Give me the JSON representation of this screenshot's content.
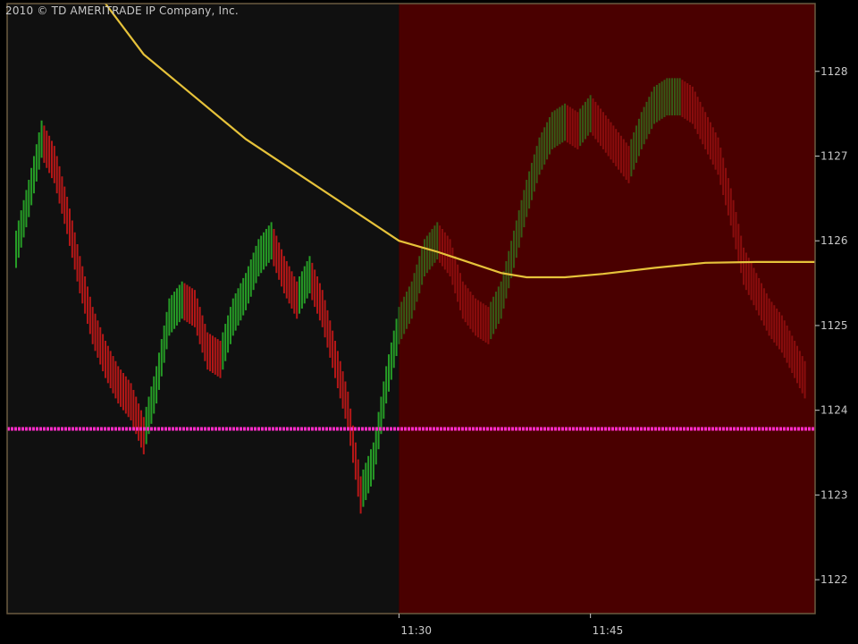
{
  "window": {
    "copyright": "2010 © TD AMERITRADE IP Company, Inc."
  },
  "colors": {
    "background": "#000000",
    "pre_session_bg": "#101010",
    "session_bg": "#4a0000",
    "up_bar": "#28a428",
    "down_bar": "#c01818",
    "moving_average": "#e6c23a",
    "support_line": "#ff2cc8",
    "axis_text": "#c8c8c8",
    "frame": "#6a5a40"
  },
  "chart_data": {
    "type": "line",
    "y_axis_ticks": [
      1128,
      1127,
      1126,
      1125,
      1124,
      1123,
      1122
    ],
    "ylim": [
      1121.6,
      1128.8
    ],
    "x_ticks": [
      {
        "label": "11:30",
        "minute": 30
      },
      {
        "label": "11:45",
        "minute": 45
      }
    ],
    "xlim_minutes": [
      -0.7,
      62.6
    ],
    "session_start_minute": 30,
    "horizontal_line": {
      "name": "",
      "value": 1123.78
    },
    "series": [
      {
        "series_type": "price_bars",
        "points": [
          [
            0,
            1125.9
          ],
          [
            1,
            1126.5
          ],
          [
            2,
            1127.2
          ],
          [
            3,
            1126.9
          ],
          [
            4,
            1126.3
          ],
          [
            5,
            1125.6
          ],
          [
            6,
            1125.0
          ],
          [
            7,
            1124.6
          ],
          [
            8,
            1124.3
          ],
          [
            9,
            1124.1
          ],
          [
            10,
            1123.7
          ],
          [
            11,
            1124.3
          ],
          [
            12,
            1125.1
          ],
          [
            13,
            1125.3
          ],
          [
            14,
            1125.2
          ],
          [
            15,
            1124.7
          ],
          [
            16,
            1124.6
          ],
          [
            17,
            1125.1
          ],
          [
            18,
            1125.4
          ],
          [
            19,
            1125.8
          ],
          [
            20,
            1126.0
          ],
          [
            21,
            1125.6
          ],
          [
            22,
            1125.3
          ],
          [
            23,
            1125.6
          ],
          [
            24,
            1125.2
          ],
          [
            25,
            1124.6
          ],
          [
            26,
            1124.0
          ],
          [
            27,
            1123.0
          ],
          [
            28,
            1123.4
          ],
          [
            29,
            1124.3
          ],
          [
            30,
            1125.0
          ],
          [
            31,
            1125.3
          ],
          [
            32,
            1125.8
          ],
          [
            33,
            1126.0
          ],
          [
            34,
            1125.8
          ],
          [
            35,
            1125.3
          ],
          [
            36,
            1125.1
          ],
          [
            37,
            1125.0
          ],
          [
            38,
            1125.3
          ],
          [
            39,
            1125.9
          ],
          [
            40,
            1126.5
          ],
          [
            41,
            1127.0
          ],
          [
            42,
            1127.3
          ],
          [
            43,
            1127.4
          ],
          [
            44,
            1127.3
          ],
          [
            45,
            1127.5
          ],
          [
            46,
            1127.3
          ],
          [
            47,
            1127.1
          ],
          [
            48,
            1126.9
          ],
          [
            49,
            1127.3
          ],
          [
            50,
            1127.6
          ],
          [
            51,
            1127.7
          ],
          [
            52,
            1127.7
          ],
          [
            53,
            1127.6
          ],
          [
            54,
            1127.3
          ],
          [
            55,
            1127.0
          ],
          [
            56,
            1126.4
          ],
          [
            57,
            1125.7
          ],
          [
            58,
            1125.4
          ],
          [
            59,
            1125.1
          ],
          [
            60,
            1124.9
          ],
          [
            61,
            1124.6
          ],
          [
            62,
            1124.3
          ]
        ]
      },
      {
        "series_type": "moving_average",
        "points": [
          [
            7,
            1128.8
          ],
          [
            10,
            1128.2
          ],
          [
            14,
            1127.7
          ],
          [
            18,
            1127.2
          ],
          [
            22,
            1126.8
          ],
          [
            26,
            1126.4
          ],
          [
            30,
            1126.0
          ],
          [
            33,
            1125.87
          ],
          [
            36,
            1125.72
          ],
          [
            38,
            1125.62
          ],
          [
            40,
            1125.57
          ],
          [
            43,
            1125.57
          ],
          [
            46,
            1125.61
          ],
          [
            50,
            1125.68
          ],
          [
            54,
            1125.74
          ],
          [
            58,
            1125.75
          ],
          [
            62.6,
            1125.75
          ]
        ]
      }
    ]
  }
}
